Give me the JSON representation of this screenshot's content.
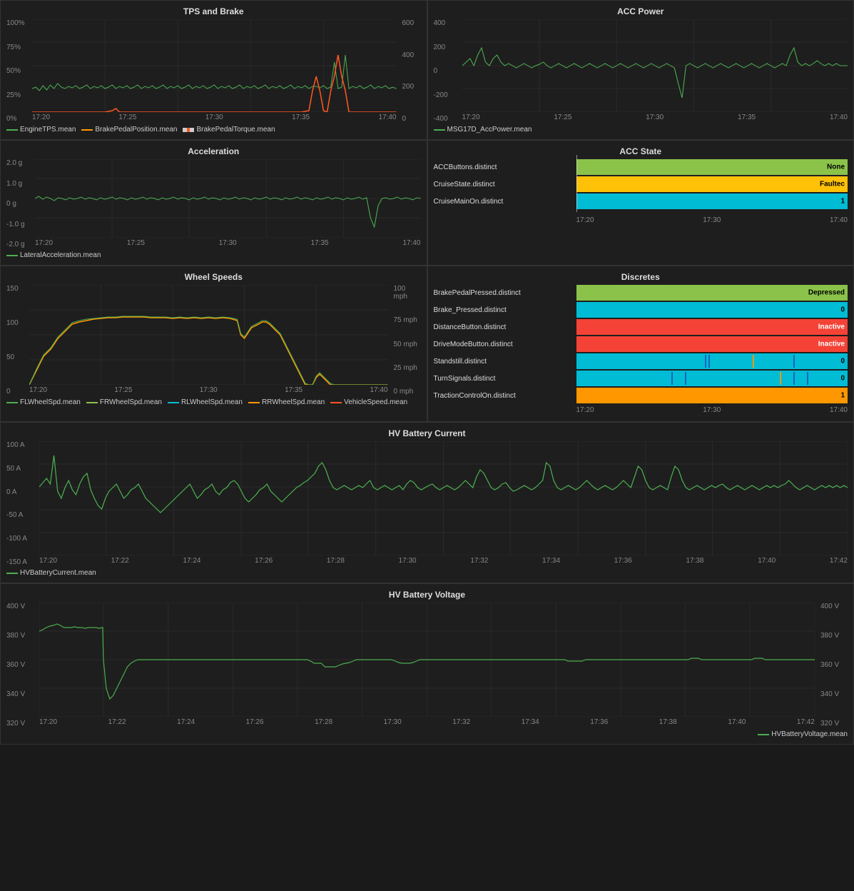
{
  "panels": {
    "tps_brake": {
      "title": "TPS and Brake",
      "y_labels_left": [
        "100%",
        "75%",
        "50%",
        "25%",
        "0%"
      ],
      "y_labels_right": [
        "600",
        "400",
        "200",
        "0"
      ],
      "x_labels": [
        "17:20",
        "17:25",
        "17:30",
        "17:35",
        "17:40"
      ],
      "legend": [
        {
          "label": "EngineTPS.mean",
          "color": "#4caf50"
        },
        {
          "label": "BrakePedalPosition.mean",
          "color": "#ff9800"
        },
        {
          "label": "BrakePedalTorque.mean",
          "color": "#ff5722"
        }
      ]
    },
    "acc_power": {
      "title": "ACC Power",
      "y_labels": [
        "400",
        "200",
        "0",
        "-200",
        "-400"
      ],
      "x_labels": [
        "17:20",
        "17:25",
        "17:30",
        "17:35",
        "17:40"
      ],
      "legend": [
        {
          "label": "MSG17D_AccPower.mean",
          "color": "#4caf50"
        }
      ]
    },
    "acceleration": {
      "title": "Acceleration",
      "y_labels": [
        "2.0 g",
        "1.0 g",
        "0 g",
        "-1.0 g",
        "-2.0 g"
      ],
      "x_labels": [
        "17:20",
        "17:25",
        "17:30",
        "17:35",
        "17:40"
      ],
      "legend": [
        {
          "label": "LateralAcceleration.mean",
          "color": "#4caf50"
        }
      ]
    },
    "acc_state": {
      "title": "ACC State",
      "rows": [
        {
          "label": "ACCButtons.distinct",
          "value": "None",
          "color": "#8bc34a"
        },
        {
          "label": "CruiseState.distinct",
          "value": "Faultec",
          "color": "#ffc107"
        },
        {
          "label": "CruiseMainOn.distinct",
          "value": "1",
          "color": "#00bcd4"
        }
      ],
      "x_labels": [
        "17:20",
        "17:30",
        "17:40"
      ]
    },
    "wheel_speeds": {
      "title": "Wheel Speeds",
      "y_labels_left": [
        "150",
        "100",
        "50",
        "0"
      ],
      "y_labels_right": [
        "100 mph",
        "75 mph",
        "50 mph",
        "25 mph",
        "0 mph"
      ],
      "x_labels": [
        "17:20",
        "17:25",
        "17:30",
        "17:35",
        "17:40"
      ],
      "legend": [
        {
          "label": "FLWheelSpd.mean",
          "color": "#4caf50"
        },
        {
          "label": "FRWheelSpd.mean",
          "color": "#8bc34a"
        },
        {
          "label": "RLWheelSpd.mean",
          "color": "#00bcd4"
        },
        {
          "label": "RRWheelSpd.mean",
          "color": "#ff9800"
        },
        {
          "label": "VehicleSpeed.mean",
          "color": "#ff5722"
        }
      ]
    },
    "discretes": {
      "title": "Discretes",
      "rows": [
        {
          "label": "BrakePedalPressed.distinct",
          "value": "Depressed",
          "color": "#8bc34a"
        },
        {
          "label": "Brake_Pressed.distinct",
          "value": "0",
          "color": "#00bcd4"
        },
        {
          "label": "DistanceButton.distinct",
          "value": "Inactive",
          "color": "#f44336"
        },
        {
          "label": "DriveModeButton.distinct",
          "value": "Inactive",
          "color": "#f44336"
        },
        {
          "label": "Standstill.distinct",
          "value": "0",
          "color": "#00bcd4"
        },
        {
          "label": "TurnSignals.distinct",
          "value": "0",
          "color": "#00bcd4"
        },
        {
          "label": "TractionControlOn.distinct",
          "value": "1",
          "color": "#ff9800"
        }
      ],
      "x_labels": [
        "17:20",
        "17:30",
        "17:40"
      ]
    },
    "hv_battery_current": {
      "title": "HV Battery Current",
      "y_labels": [
        "100 A",
        "50 A",
        "0 A",
        "-50 A",
        "-100 A",
        "-150 A"
      ],
      "x_labels": [
        "17:20",
        "17:22",
        "17:24",
        "17:26",
        "17:28",
        "17:30",
        "17:32",
        "17:34",
        "17:36",
        "17:38",
        "17:40",
        "17:42"
      ],
      "legend": [
        {
          "label": "HVBatteryCurrent.mean",
          "color": "#4caf50"
        }
      ]
    },
    "hv_battery_voltage": {
      "title": "HV Battery Voltage",
      "y_labels_left": [
        "400 V",
        "380 V",
        "360 V",
        "340 V",
        "320 V"
      ],
      "y_labels_right": [
        "400 V",
        "380 V",
        "360 V",
        "340 V",
        "320 V"
      ],
      "x_labels": [
        "17:20",
        "17:22",
        "17:24",
        "17:26",
        "17:28",
        "17:30",
        "17:32",
        "17:34",
        "17:36",
        "17:38",
        "17:40",
        "17:42"
      ],
      "legend": [
        {
          "label": "HVBatteryVoltage.mean",
          "color": "#4caf50"
        }
      ]
    }
  },
  "colors": {
    "background": "#1a1a1a",
    "panel_bg": "#1e1e1e",
    "border": "#333",
    "text": "#ccc",
    "grid_line": "#2a2a2a",
    "green": "#4caf50",
    "orange": "#ff9800",
    "red_orange": "#ff5722",
    "cyan": "#00bcd4",
    "yellow": "#ffc107",
    "light_green": "#8bc34a",
    "red": "#f44336"
  }
}
